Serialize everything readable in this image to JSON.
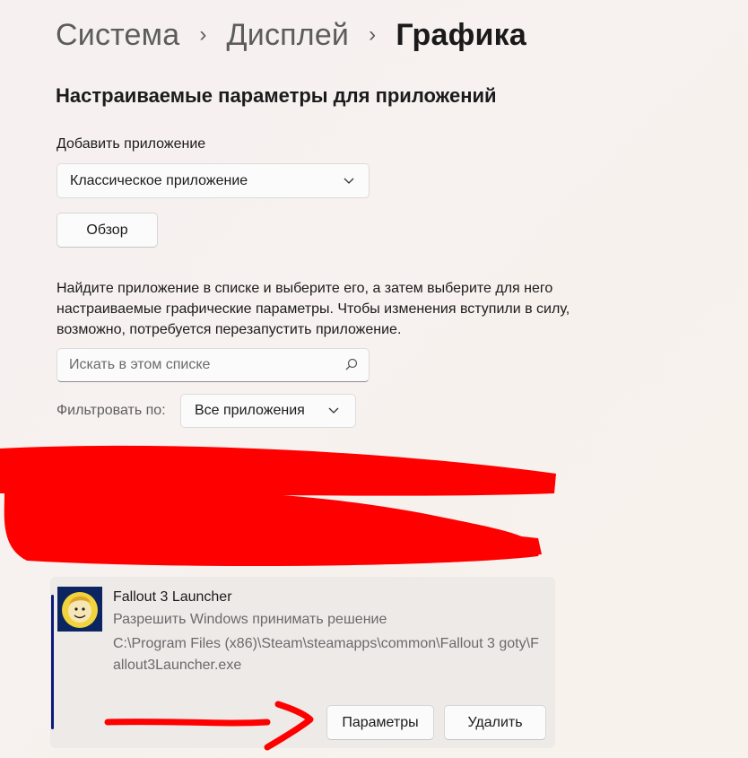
{
  "breadcrumb": {
    "items": [
      "Система",
      "Дисплей",
      "Графика"
    ],
    "separator": "›"
  },
  "section_title": "Настраиваемые параметры для приложений",
  "add_app": {
    "label": "Добавить приложение",
    "type_selected": "Классическое приложение",
    "browse_button": "Обзор"
  },
  "description": "Найдите приложение в списке и выберите его, а затем выберите для него настраиваемые графические параметры. Чтобы изменения вступили в силу, возможно, потребуется перезапустить приложение.",
  "search": {
    "placeholder": "Искать в этом списке",
    "icon": "search-icon"
  },
  "filter": {
    "label": "Фильтровать по:",
    "selected": "Все приложения"
  },
  "app_entry": {
    "name": "Fallout 3 Launcher",
    "preference": "Разрешить Windows принимать решение",
    "path": "C:\\Program Files (x86)\\Steam\\steamapps\\common\\Fallout 3 goty\\Fallout3Launcher.exe",
    "options_button": "Параметры",
    "remove_button": "Удалить",
    "icon": "vault-boy-icon"
  },
  "colors": {
    "background": "#f6f1f0",
    "card": "#eeeae8",
    "accent": "#0a1a7a",
    "annotation_red": "#ff0000"
  }
}
